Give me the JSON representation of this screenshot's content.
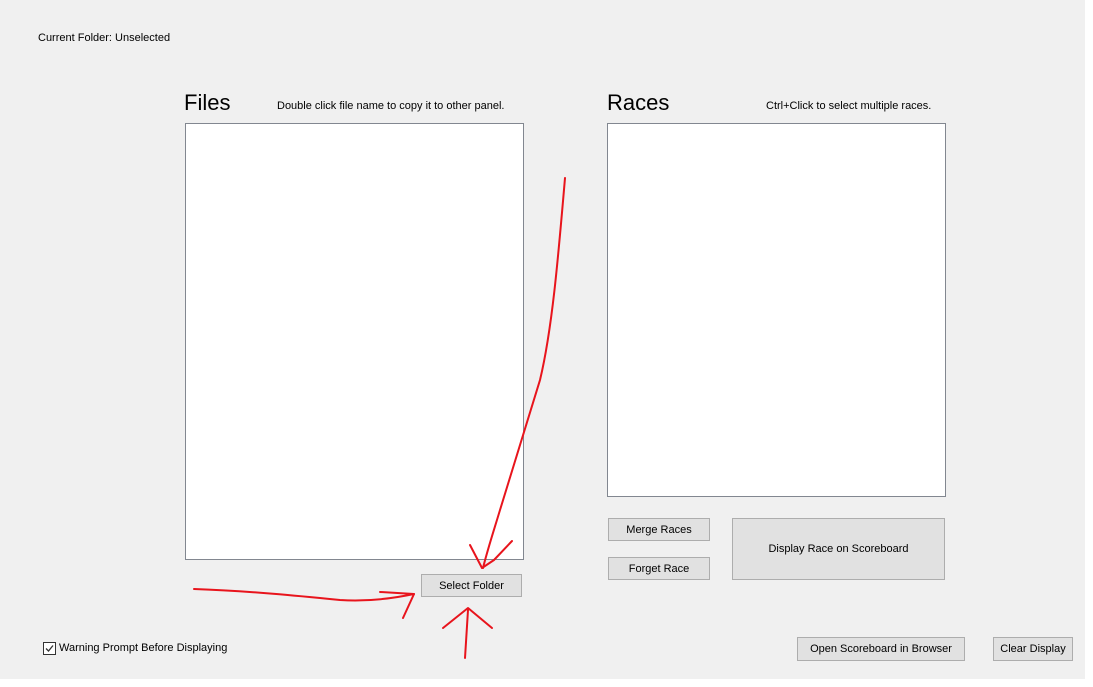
{
  "header": {
    "current_folder_label": "Current Folder: Unselected"
  },
  "files_panel": {
    "title": "Files",
    "hint": "Double click file name to copy it to other panel.",
    "items": [],
    "select_folder_label": "Select Folder"
  },
  "races_panel": {
    "title": "Races",
    "hint": "Ctrl+Click to select multiple races.",
    "items": [],
    "merge_label": "Merge Races",
    "forget_label": "Forget Race",
    "display_label": "Display Race on Scoreboard"
  },
  "footer": {
    "warning_checkbox_label": "Warning Prompt Before Displaying",
    "warning_checked": true,
    "open_browser_label": "Open Scoreboard in Browser",
    "clear_display_label": "Clear Display"
  },
  "annotation_color": "#e8141c"
}
